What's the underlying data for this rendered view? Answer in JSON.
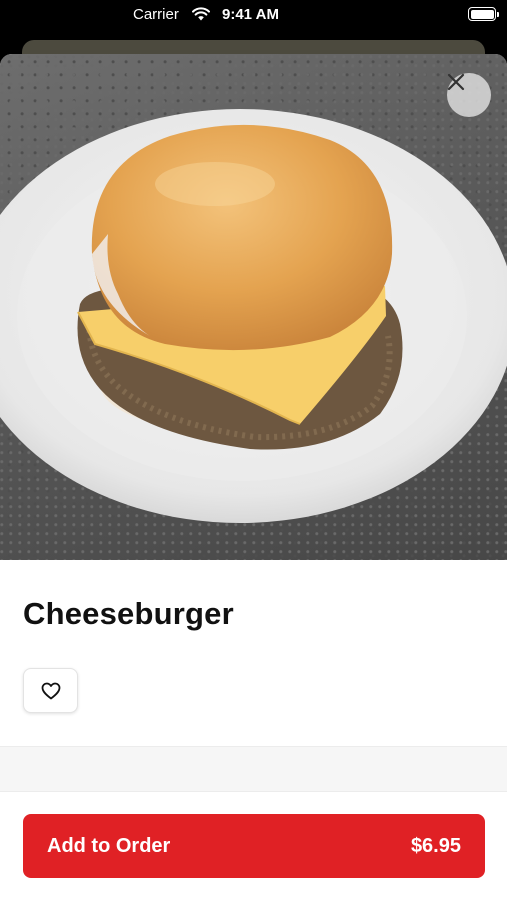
{
  "status_bar": {
    "carrier": "Carrier",
    "time": "9:41 AM",
    "wifi_icon": "wifi-icon",
    "battery_icon": "battery-icon"
  },
  "item": {
    "name": "Cheeseburger",
    "image": "cheeseburger-photo"
  },
  "actions": {
    "close_icon": "close-icon",
    "favorite_icon": "heart-icon",
    "add_label": "Add to Order",
    "price": "$6.95"
  },
  "colors": {
    "accent": "#e02125",
    "title": "#111111",
    "background": "#ffffff"
  }
}
